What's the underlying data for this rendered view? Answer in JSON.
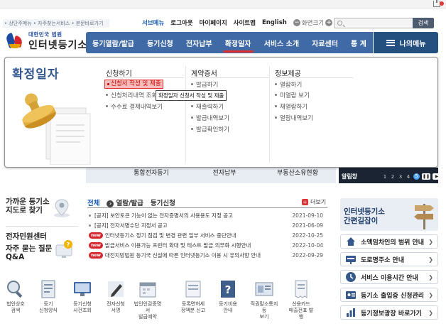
{
  "skip_links": "• 상단주메뉴 • 자주찾는서비스 • 본문바로가기",
  "util": {
    "items": [
      "서브메뉴",
      "로그아웃",
      "마이페이지",
      "사이트맵",
      "English"
    ],
    "font_size": "화면크기",
    "search_button": "검색"
  },
  "logo": {
    "top": "대한민국 법원",
    "name": "인터넷등기소"
  },
  "gnb": {
    "items": [
      "등기열람/발급",
      "등기신청",
      "전자납부",
      "확정일자",
      "서비스 소개",
      "자료센터",
      "통 계"
    ],
    "my_menu": "나의메뉴"
  },
  "mega": {
    "title": "확정일자",
    "columns": [
      {
        "heading": "신청하기",
        "items": [
          "신청서 작성 및 제출",
          "신청처리내역 조회",
          "수수료 결제내역보기"
        ]
      },
      {
        "heading": "계약증서",
        "items": [
          "발급하기",
          "발급",
          "재출력하기",
          "발급내역보기",
          "발급확인하기"
        ]
      },
      {
        "heading": "정보제공",
        "items": [
          "열람하기",
          "미열람 보기",
          "재열람하기",
          "열람내역보기"
        ]
      }
    ],
    "tooltip": "확정일자 신청서 작성 및 제출"
  },
  "banner": {
    "items": [
      "통합전자등기",
      "전자납부",
      "부동산소유현황"
    ]
  },
  "alarm": {
    "label": "알림창",
    "pages": [
      "1",
      "2",
      "3",
      "4",
      "5"
    ],
    "current": "5"
  },
  "left": {
    "map": {
      "line1": "가까운 등기소",
      "line2": "지도로 찾기"
    },
    "civil": "전자민원센터",
    "faq": {
      "line1": "자주 묻는 질문",
      "line2": "Q&A"
    }
  },
  "notice": {
    "tabs": [
      "전체",
      "열람/발급",
      "등기신청"
    ],
    "more": "더보기",
    "rows": [
      {
        "new": false,
        "text": "[공지] 보안토큰 기능이 없는 전자증명서의 사용용도 지정 공고",
        "date": "2021-09-10"
      },
      {
        "new": false,
        "text": "[공지] 전자서명수단 지정서 공고",
        "date": "2021-06-09"
      },
      {
        "new": true,
        "text": "인터넷등기소 정기 점검 및 변경 관련 일부 서비스 중단안내",
        "date": "2022-10-25"
      },
      {
        "new": true,
        "text": "발급서비스 이용가능 프린터 확대 및 테스트 발급 의무화 시행안내",
        "date": "2022-10-04"
      },
      {
        "new": true,
        "text": "대전지방법원 등기국 신설에 따른 인터넷등기소 이용 시 유의사항 안내",
        "date": "2022-09-29"
      }
    ],
    "new_badge": "new"
  },
  "right": {
    "banner": {
      "line1": "인터넷등기소",
      "line2": "간편길잡이"
    },
    "quick": [
      "소액임차인의 범위 안내",
      "도로명주소 안내",
      "서비스 이용시간 안내",
      "등기소 출입증 신청관리",
      "등기정보광장 바로가기"
    ]
  },
  "bottom": [
    {
      "l1": "법인상호",
      "l2": "검색"
    },
    {
      "l1": "등기",
      "l2": "신청양식"
    },
    {
      "l1": "등기신청",
      "l2": "사건조회"
    },
    {
      "l1": "전자신청",
      "l2": "서명"
    },
    {
      "l1": "법인인감증명서",
      "l2": "발급예약"
    },
    {
      "l1": "등록면허세",
      "l2": "정액분 신고"
    },
    {
      "l1": "등기비용",
      "l2": "안내"
    },
    {
      "l1": "직권말소통지등",
      "l2": "보기"
    },
    {
      "l1": "신용카드",
      "l2": "매출전표 발행"
    }
  ],
  "colors": {
    "nav": "#3f6aa5",
    "nav_dark": "#23507f",
    "accent_red": "#e03131",
    "title_blue": "#35598d"
  }
}
